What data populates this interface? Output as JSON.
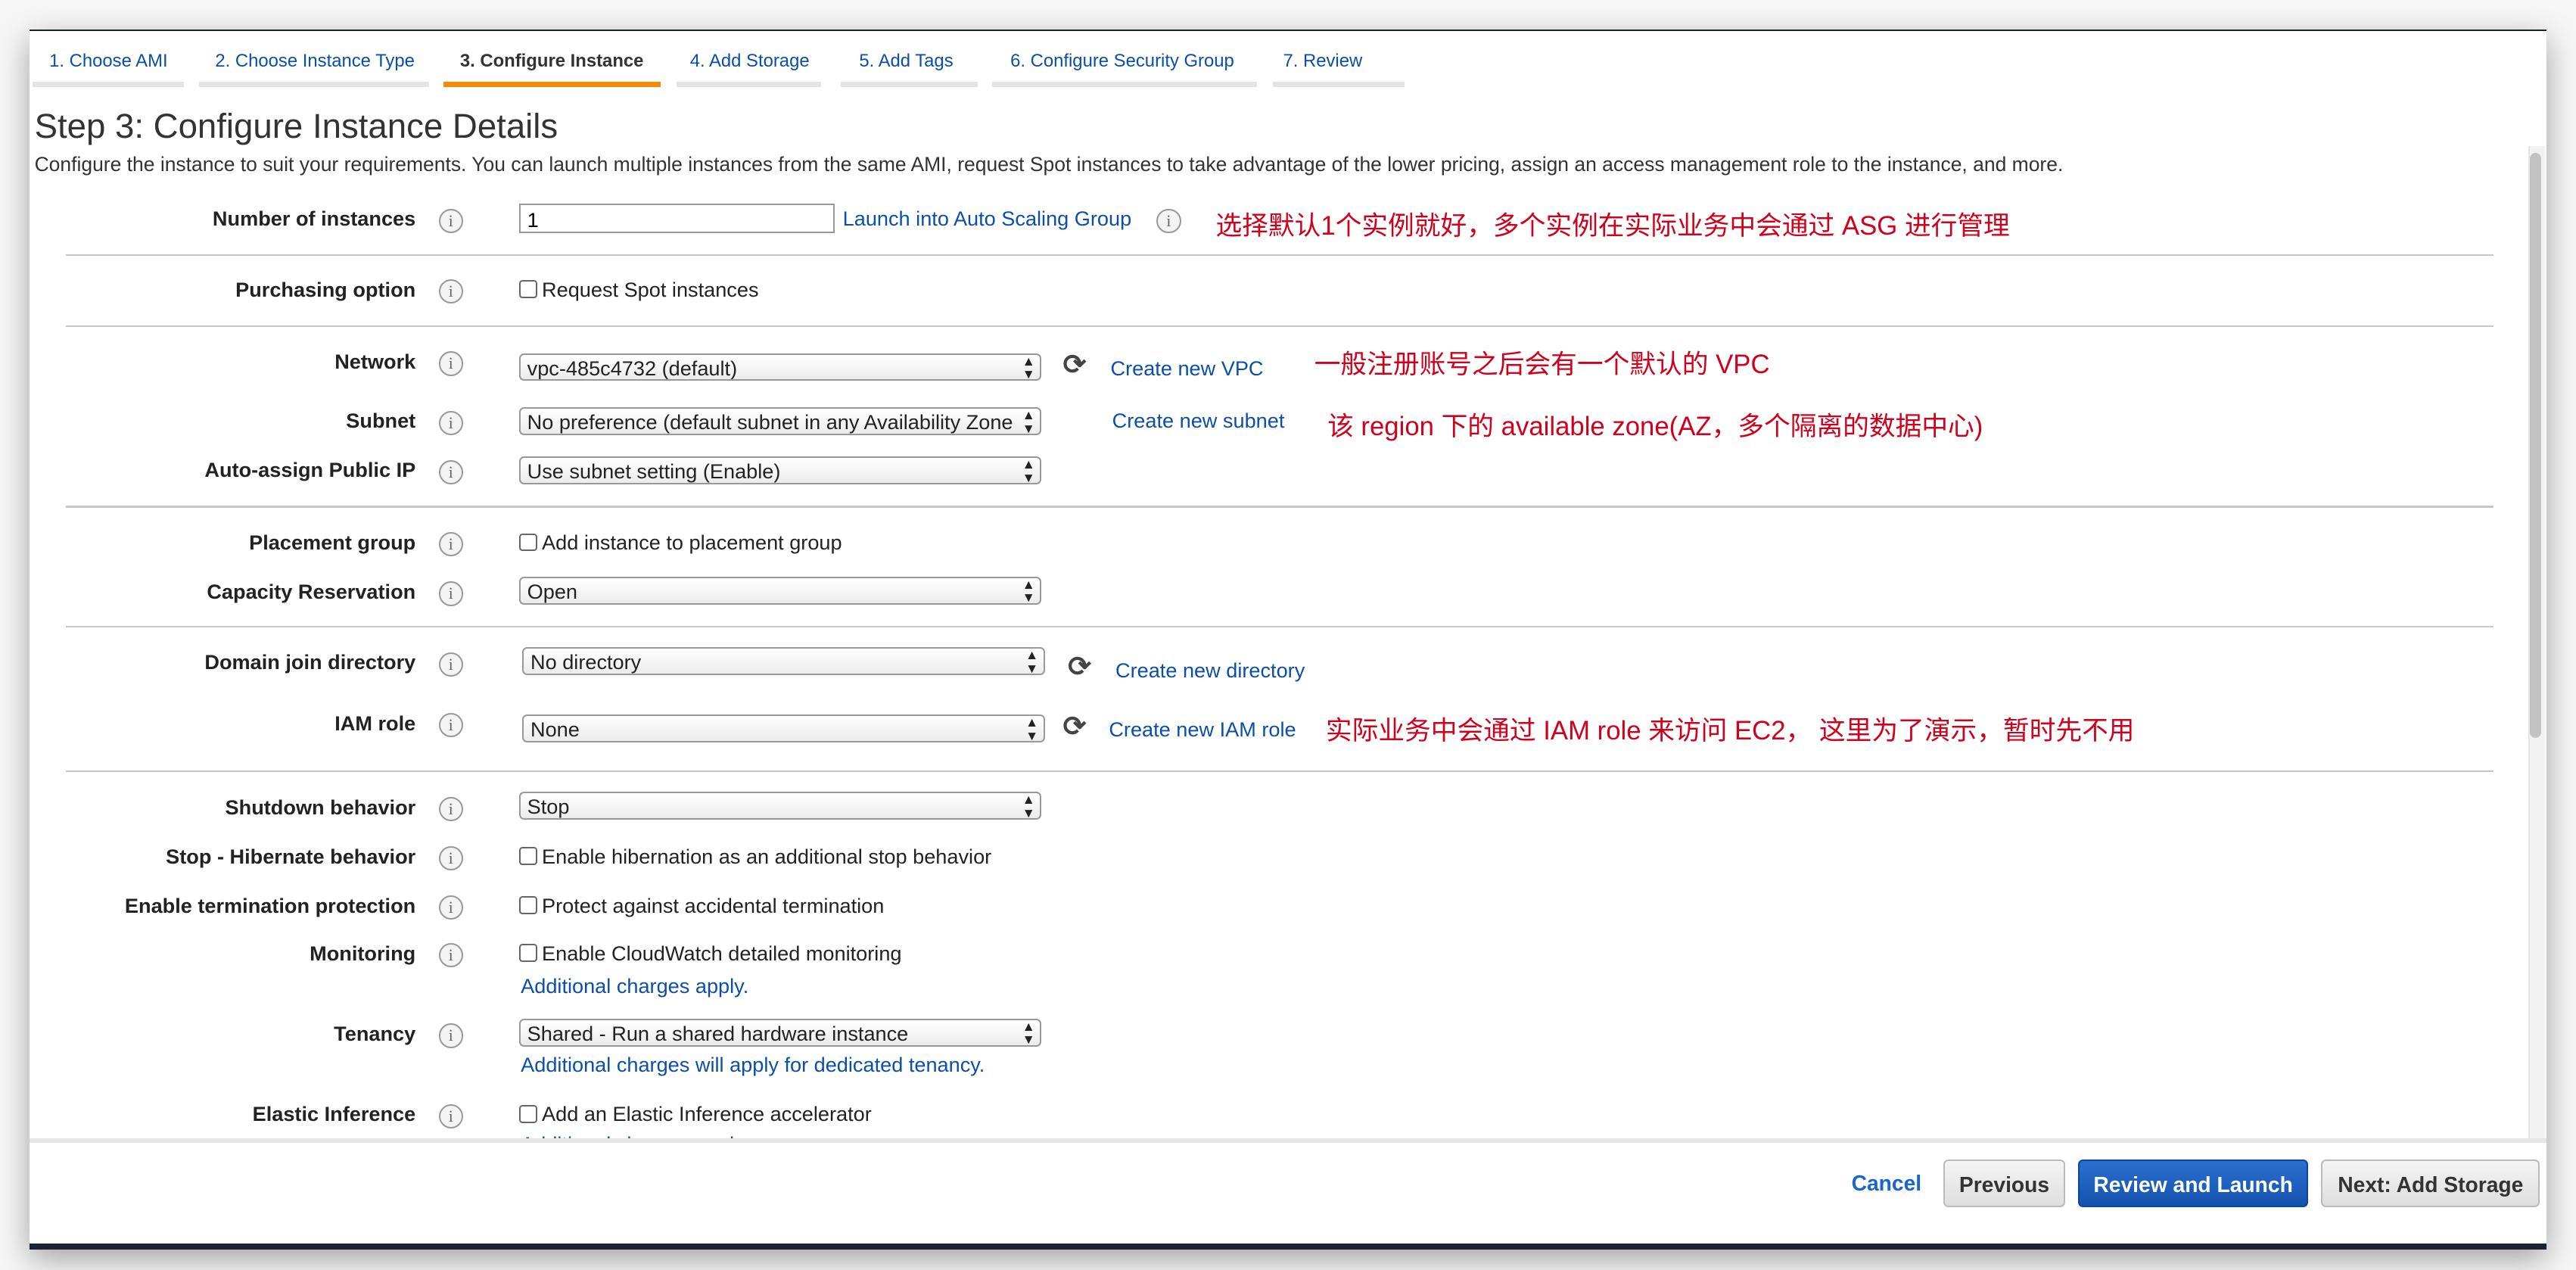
{
  "tabs": [
    {
      "label": "1. Choose AMI",
      "active": false
    },
    {
      "label": "2. Choose Instance Type",
      "active": false
    },
    {
      "label": "3. Configure Instance",
      "active": true
    },
    {
      "label": "4. Add Storage",
      "active": false
    },
    {
      "label": "5. Add Tags",
      "active": false
    },
    {
      "label": "6. Configure Security Group",
      "active": false
    },
    {
      "label": "7. Review",
      "active": false
    }
  ],
  "page": {
    "title": "Step 3: Configure Instance Details",
    "description": "Configure the instance to suit your requirements. You can launch multiple instances from the same AMI, request Spot instances to take advantage of the lower pricing, assign an access management role to the instance, and more."
  },
  "fields": {
    "instances": {
      "label": "Number of instances",
      "value": "1",
      "link": "Launch into Auto Scaling Group"
    },
    "purchasing": {
      "label": "Purchasing option",
      "checkbox": "Request Spot instances"
    },
    "network": {
      "label": "Network",
      "value": "vpc-485c4732 (default)",
      "link": "Create new VPC"
    },
    "subnet": {
      "label": "Subnet",
      "value": "No preference (default subnet in any Availability Zone",
      "link": "Create new subnet"
    },
    "public_ip": {
      "label": "Auto-assign Public IP",
      "value": "Use subnet setting (Enable)"
    },
    "placement": {
      "label": "Placement group",
      "checkbox": "Add instance to placement group"
    },
    "capacity": {
      "label": "Capacity Reservation",
      "value": "Open"
    },
    "domain": {
      "label": "Domain join directory",
      "value": "No directory",
      "link": "Create new directory"
    },
    "iam": {
      "label": "IAM role",
      "value": "None",
      "link": "Create new IAM role"
    },
    "shutdown": {
      "label": "Shutdown behavior",
      "value": "Stop"
    },
    "hibernate": {
      "label": "Stop - Hibernate behavior",
      "checkbox": "Enable hibernation as an additional stop behavior"
    },
    "termination": {
      "label": "Enable termination protection",
      "checkbox": "Protect against accidental termination"
    },
    "monitoring": {
      "label": "Monitoring",
      "checkbox": "Enable CloudWatch detailed monitoring",
      "note": "Additional charges apply."
    },
    "tenancy": {
      "label": "Tenancy",
      "value": "Shared - Run a shared hardware instance",
      "note": "Additional charges will apply for dedicated tenancy."
    },
    "elastic": {
      "label": "Elastic Inference",
      "checkbox": "Add an Elastic Inference accelerator",
      "note": "Additional charges apply."
    }
  },
  "annotations": {
    "instances": "选择默认1个实例就好，多个实例在实际业务中会通过 ASG 进行管理",
    "network": "一般注册账号之后会有一个默认的 VPC",
    "subnet": "该 region 下的 available zone(AZ，多个隔离的数据中心)",
    "iam": "实际业务中会通过 IAM role 来访问 EC2， 这里为了演示，暂时先不用"
  },
  "footer": {
    "cancel": "Cancel",
    "previous": "Previous",
    "review": "Review and Launch",
    "next": "Next: Add Storage"
  },
  "colors": {
    "accent": "#f58a07",
    "link": "#0b4fa8",
    "primary_button": "#1a5cc0",
    "annotation": "#d0021b"
  },
  "icons": {
    "info": "i",
    "refresh": "⟳",
    "select_arrow": "▴▾"
  }
}
